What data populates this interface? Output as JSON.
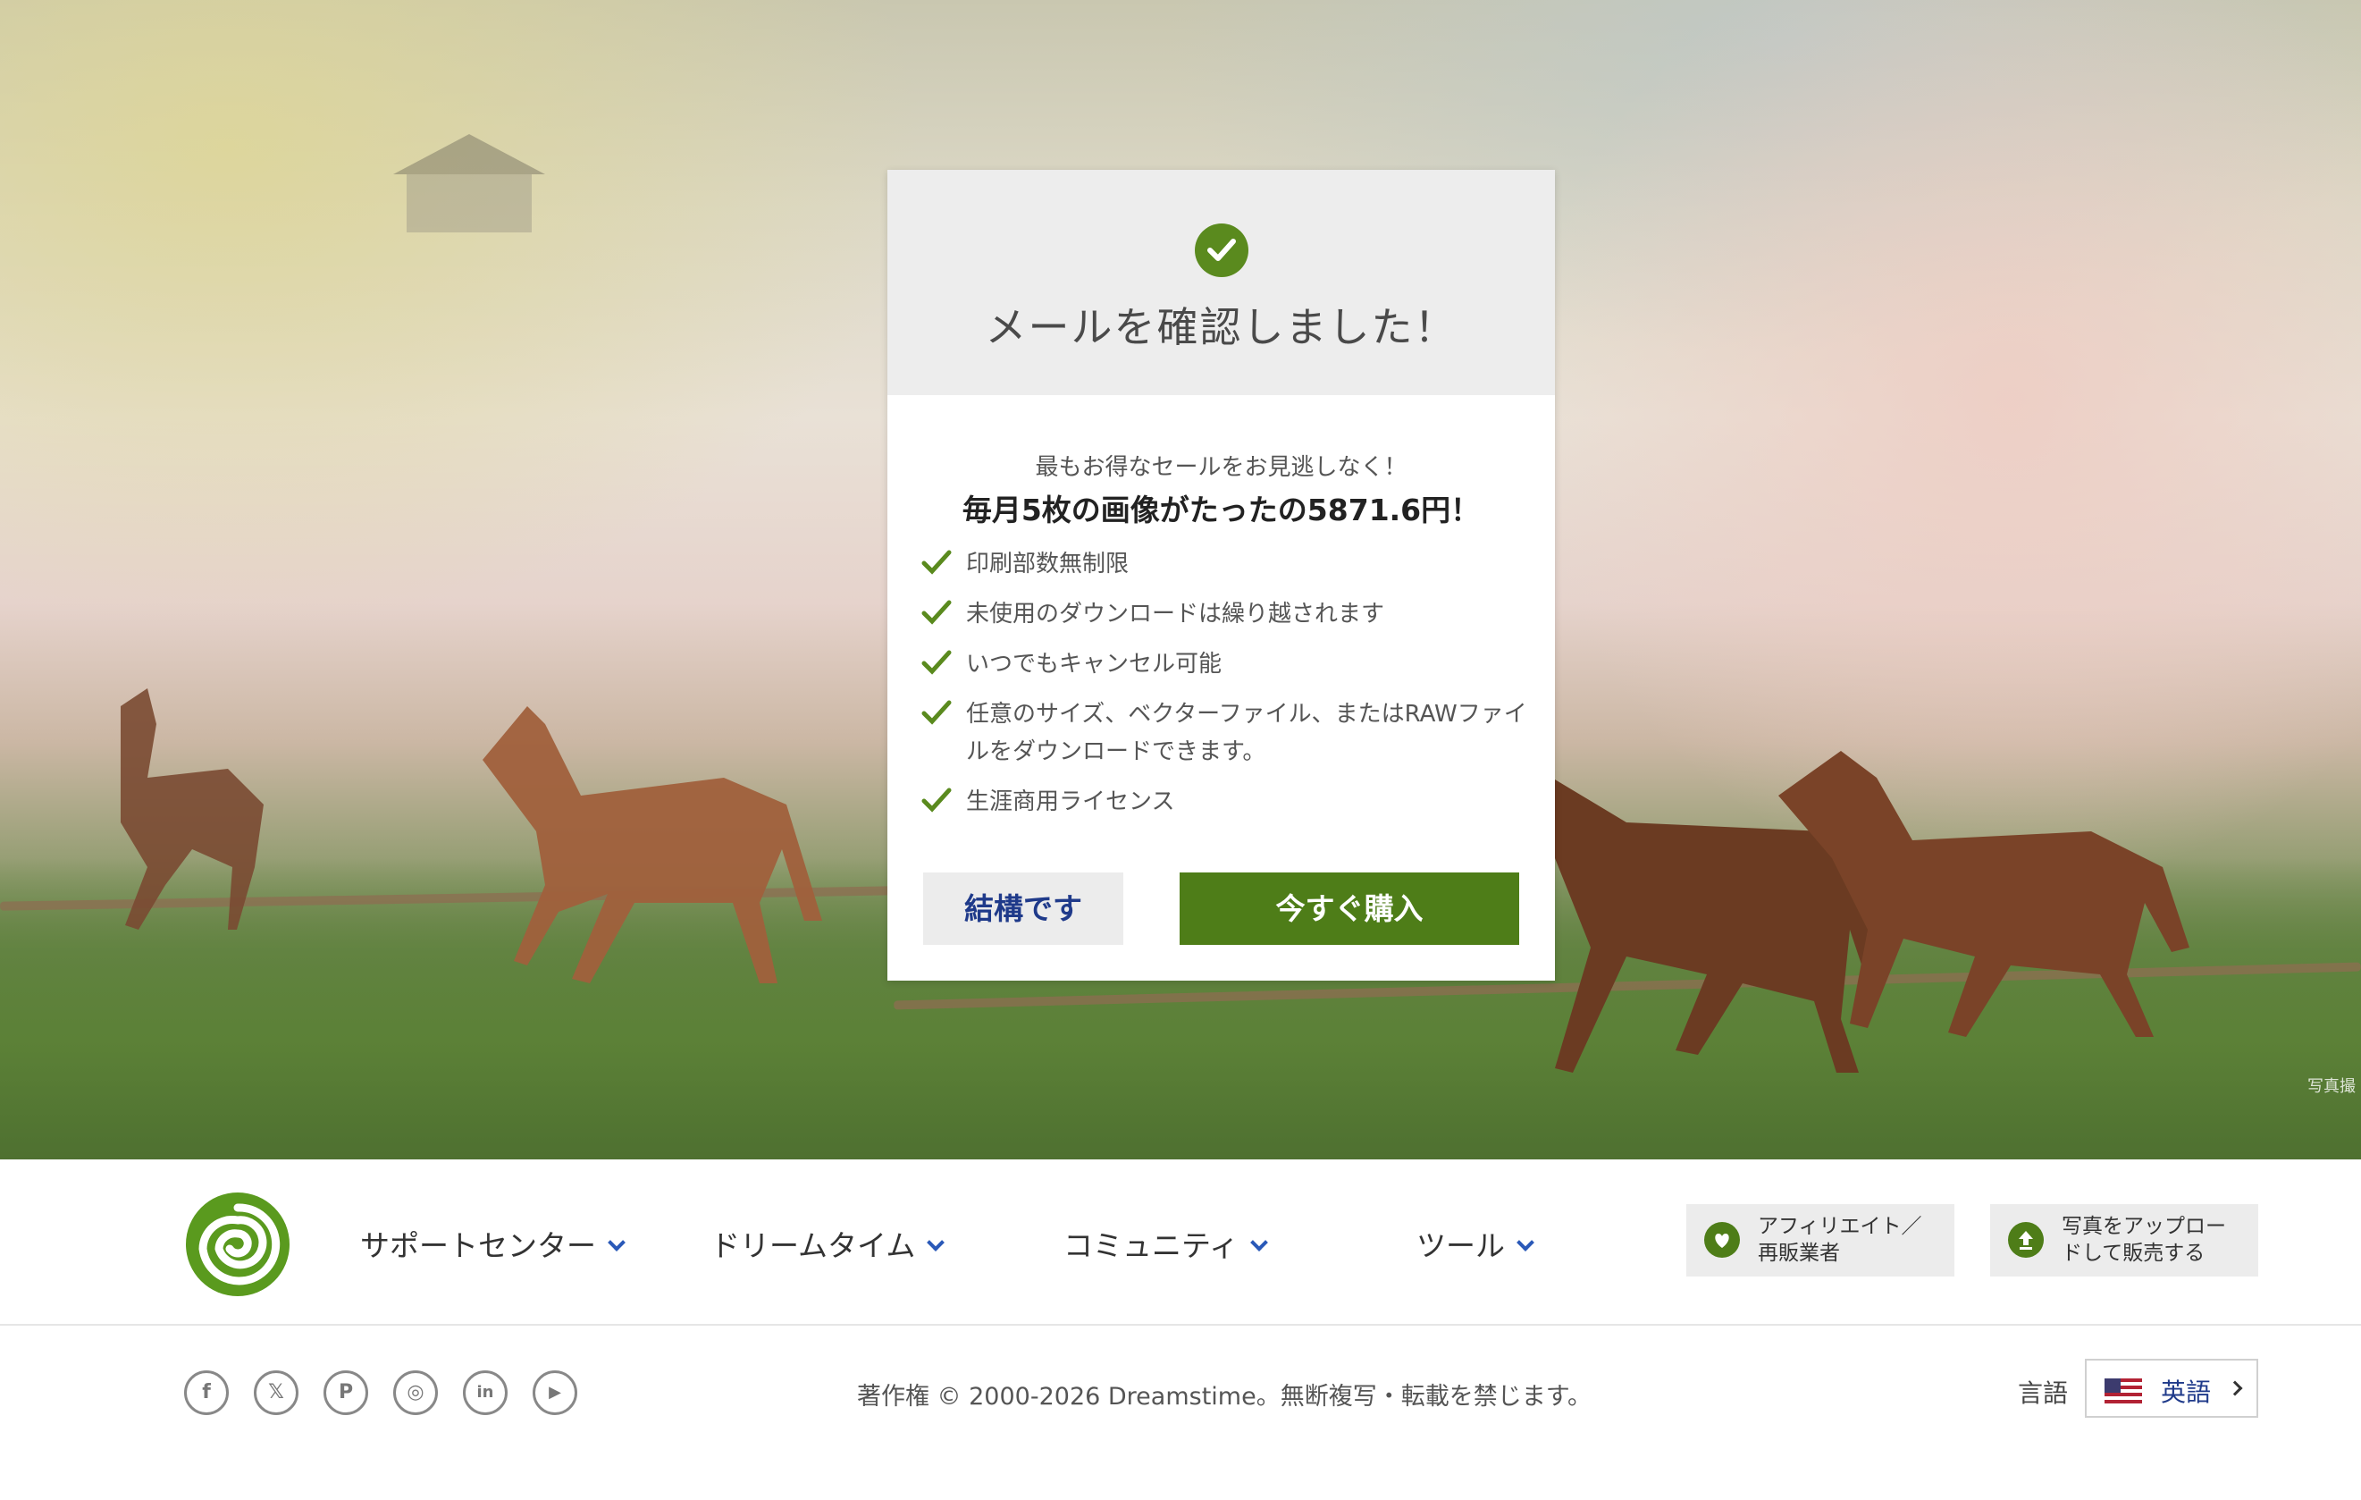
{
  "modal": {
    "title": "メールを確認しました！",
    "subtitle": "最もお得なセールをお見逃しなく！",
    "offer": "毎月5枚の画像がたったの5871.6円！",
    "features": [
      "印刷部数無制限",
      "未使用のダウンロードは繰り越されます",
      "いつでもキャンセル可能",
      "任意のサイズ、ベクターファイル、またはRAWファイルをダウンロードできます。",
      "生涯商用ライセンス"
    ],
    "decline_label": "結構です",
    "buy_label": "今すぐ購入"
  },
  "photo_credit": "写真撮 ハナテ",
  "footer": {
    "nav": [
      {
        "label": "サポートセンター"
      },
      {
        "label": "ドリームタイム"
      },
      {
        "label": "コミュニティ"
      },
      {
        "label": "ツール"
      }
    ],
    "affiliate": {
      "line1": "アフィリエイト／",
      "line2": "再販業者"
    },
    "upload": {
      "line1": "写真をアップロー",
      "line2": "ドして販売する"
    },
    "social": [
      {
        "icon": "facebook-icon",
        "glyph": "f"
      },
      {
        "icon": "x-icon",
        "glyph": "𝕏"
      },
      {
        "icon": "pinterest-icon",
        "glyph": "P"
      },
      {
        "icon": "instagram-icon",
        "glyph": "◎"
      },
      {
        "icon": "linkedin-icon",
        "glyph": "in"
      },
      {
        "icon": "youtube-icon",
        "glyph": "▶"
      }
    ],
    "copyright": "著作権 © 2000-2026 Dreamstime。無断複写・転載を禁じます。",
    "language_label": "言語",
    "language_value": "英語"
  },
  "colors": {
    "brand_green": "#4e7d18",
    "link_blue": "#1f3a8a"
  }
}
